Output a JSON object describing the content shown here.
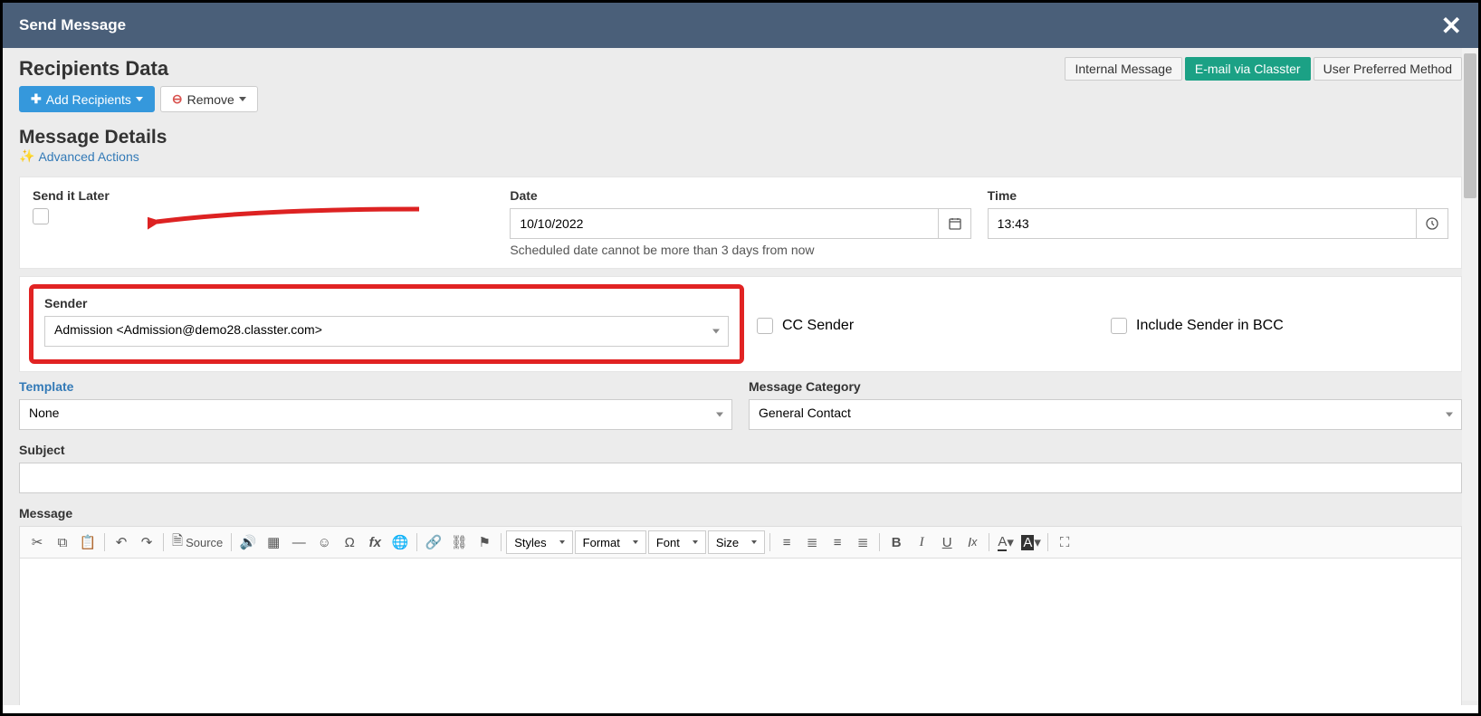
{
  "header": {
    "title": "Send Message"
  },
  "tabs": {
    "internal": "Internal Message",
    "email": "E-mail via Classter",
    "preferred": "User Preferred Method"
  },
  "recipients": {
    "title": "Recipients Data",
    "add_btn": "Add Recipients",
    "remove_btn": "Remove"
  },
  "details": {
    "title": "Message Details",
    "advanced": "Advanced Actions",
    "send_later_lbl": "Send it Later",
    "date_lbl": "Date",
    "date_val": "10/10/2022",
    "date_help": "Scheduled date cannot be more than 3 days from now",
    "time_lbl": "Time",
    "time_val": "13:43",
    "sender_lbl": "Sender",
    "sender_val": "Admission <Admission@demo28.classter.com>",
    "cc_lbl": "CC Sender",
    "bcc_lbl": "Include Sender in BCC",
    "template_lbl": "Template",
    "template_val": "None",
    "category_lbl": "Message Category",
    "category_val": "General Contact",
    "subject_lbl": "Subject",
    "message_lbl": "Message"
  },
  "toolbar": {
    "source": "Source",
    "styles": "Styles",
    "format": "Format",
    "font": "Font",
    "size": "Size"
  }
}
